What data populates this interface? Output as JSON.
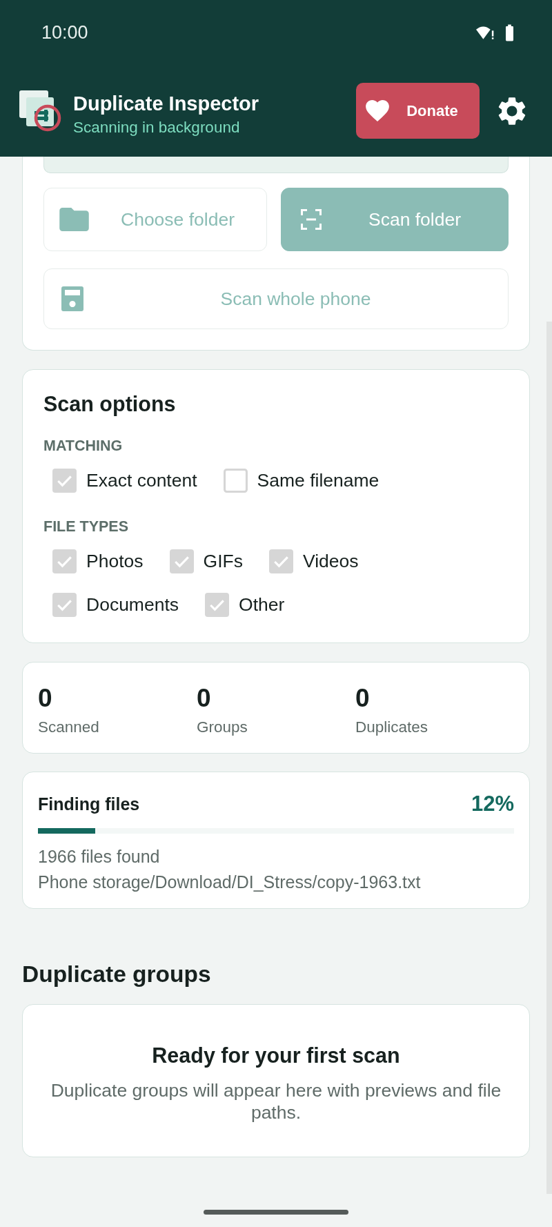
{
  "status_bar": {
    "time": "10:00"
  },
  "app_bar": {
    "title": "Duplicate Inspector",
    "subtitle": "Scanning in background",
    "donate_button": {
      "label": "Donate"
    }
  },
  "scan_actions": {
    "buttons": [
      {
        "label": "Choose folder",
        "kind": "folder",
        "primary": false,
        "disabled": true
      },
      {
        "label": "Scan folder",
        "kind": "scan",
        "primary": true,
        "disabled": true
      },
      {
        "label": "Scan whole phone",
        "kind": "phone",
        "primary": false,
        "disabled": true
      }
    ]
  },
  "scan_options": {
    "title": "Scan options",
    "groups": [
      {
        "label": "MATCHING",
        "options": [
          {
            "label": "Exact content",
            "checked": true,
            "disabled": true
          },
          {
            "label": "Same filename",
            "checked": false,
            "disabled": true
          }
        ]
      },
      {
        "label": "FILE TYPES",
        "options": [
          {
            "label": "Photos",
            "checked": true,
            "disabled": true
          },
          {
            "label": "GIFs",
            "checked": true,
            "disabled": true
          },
          {
            "label": "Videos",
            "checked": true,
            "disabled": true
          },
          {
            "label": "Documents",
            "checked": true,
            "disabled": true
          },
          {
            "label": "Other",
            "checked": true,
            "disabled": true
          }
        ]
      }
    ]
  },
  "stats": [
    {
      "value": "0",
      "label": "Scanned"
    },
    {
      "value": "0",
      "label": "Groups"
    },
    {
      "value": "0",
      "label": "Duplicates"
    }
  ],
  "progress": {
    "title": "Finding files",
    "percent": "12%",
    "level": 0.12,
    "lines": [
      "1966 files found",
      "Phone storage/Download/DI_Stress/copy-1963.txt"
    ]
  },
  "duplicate_groups": {
    "heading": "Duplicate groups",
    "empty_state": {
      "title": "Ready for your first scan",
      "message": "Duplicate groups will appear here with previews and file paths."
    }
  }
}
